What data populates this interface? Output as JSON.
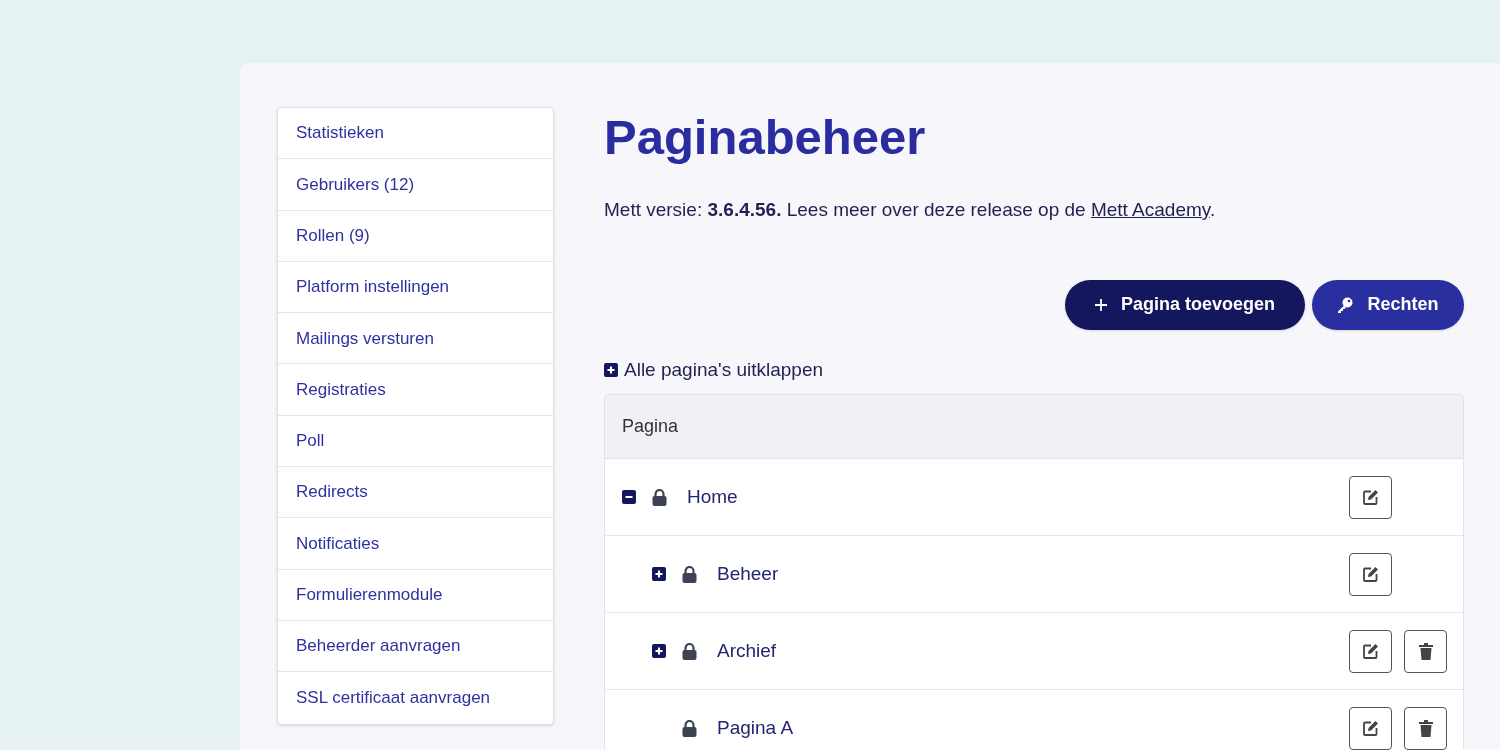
{
  "sidebar": {
    "items": [
      {
        "label": "Statistieken"
      },
      {
        "label": "Gebruikers (12)"
      },
      {
        "label": "Rollen (9)"
      },
      {
        "label": "Platform instellingen"
      },
      {
        "label": "Mailings versturen"
      },
      {
        "label": "Registraties"
      },
      {
        "label": "Poll"
      },
      {
        "label": "Redirects"
      },
      {
        "label": "Notificaties"
      },
      {
        "label": "Formulierenmodule"
      },
      {
        "label": "Beheerder aanvragen"
      },
      {
        "label": "SSL certificaat aanvragen"
      }
    ]
  },
  "title": "Paginabeheer",
  "version_text": "Mett versie: **3.6.4.56.** Lees meer over deze release op de ",
  "version_link": "Mett Academy",
  "version_end": ".",
  "buttons": [
    {
      "kind": "add",
      "label": "Pagina toevoegen"
    },
    {
      "kind": "rights",
      "label": "Rechten"
    }
  ],
  "expand_all": "Alle pagina's uitklappen",
  "table": {
    "column": "Pagina",
    "rows": [
      {
        "label": "Home",
        "locked": true,
        "expanded": true,
        "deletable": false,
        "children": [
          {
            "label": "Beheer",
            "locked": true,
            "expanded": false,
            "deletable": false
          },
          {
            "label": "Archief",
            "locked": true,
            "expanded": false,
            "deletable": true
          },
          {
            "label": "Pagina A",
            "locked": true,
            "deletable": true
          }
        ]
      }
    ]
  }
}
